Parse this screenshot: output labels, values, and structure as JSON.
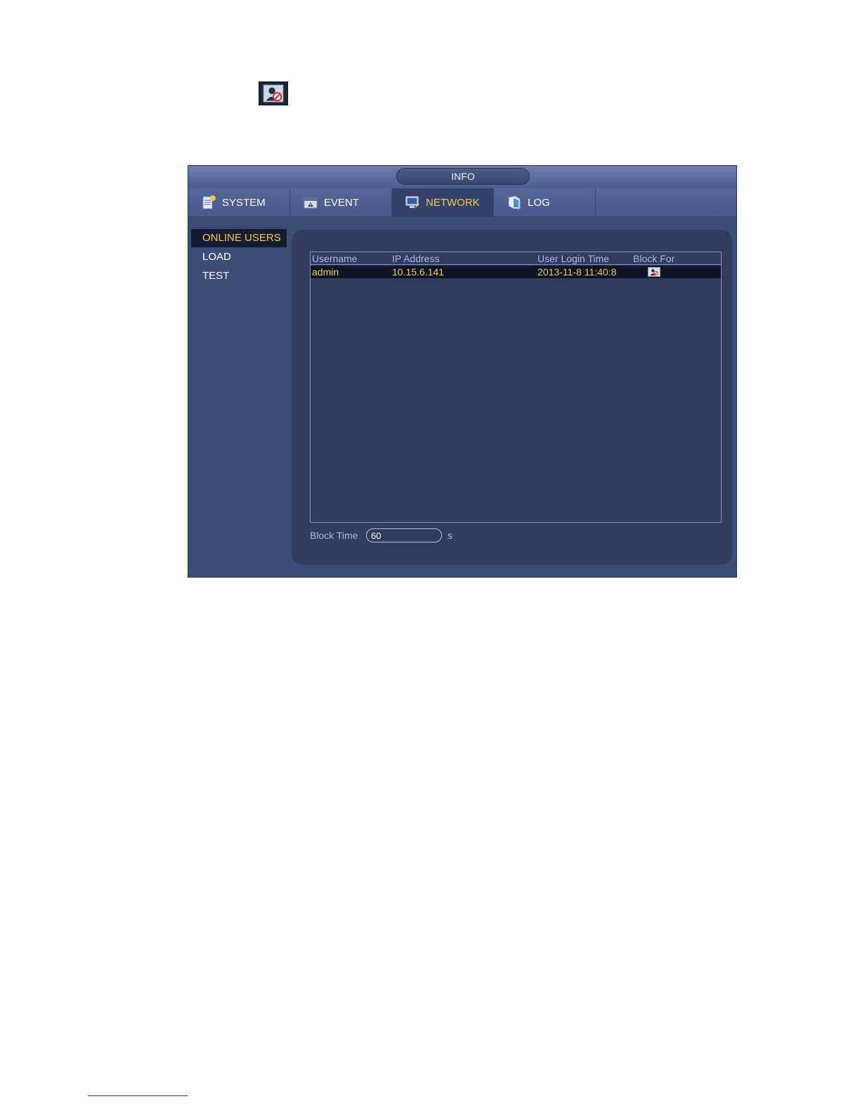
{
  "window": {
    "title": "INFO"
  },
  "tabs": [
    {
      "label": "SYSTEM",
      "icon": "system-icon"
    },
    {
      "label": "EVENT",
      "icon": "event-icon"
    },
    {
      "label": "NETWORK",
      "icon": "network-icon",
      "active": true
    },
    {
      "label": "LOG",
      "icon": "log-icon"
    }
  ],
  "sidebar": {
    "items": [
      {
        "label": "ONLINE USERS",
        "active": true
      },
      {
        "label": "LOAD"
      },
      {
        "label": "TEST"
      }
    ]
  },
  "table": {
    "columns": [
      "Username",
      "IP Address",
      "User Login Time",
      "Block For"
    ],
    "rows": [
      {
        "username": "admin",
        "ip": "10.15.6.141",
        "login_time": "2013-11-8 11:40:8",
        "block_icon": "block-user-icon"
      }
    ]
  },
  "block_time": {
    "label": "Block Time",
    "value": "60",
    "unit": "s"
  },
  "colors": {
    "window_bg": "#3e4d76",
    "panel_bg": "#323c5e",
    "accent": "#f2c94c",
    "header_text": "#a9b8e8"
  }
}
